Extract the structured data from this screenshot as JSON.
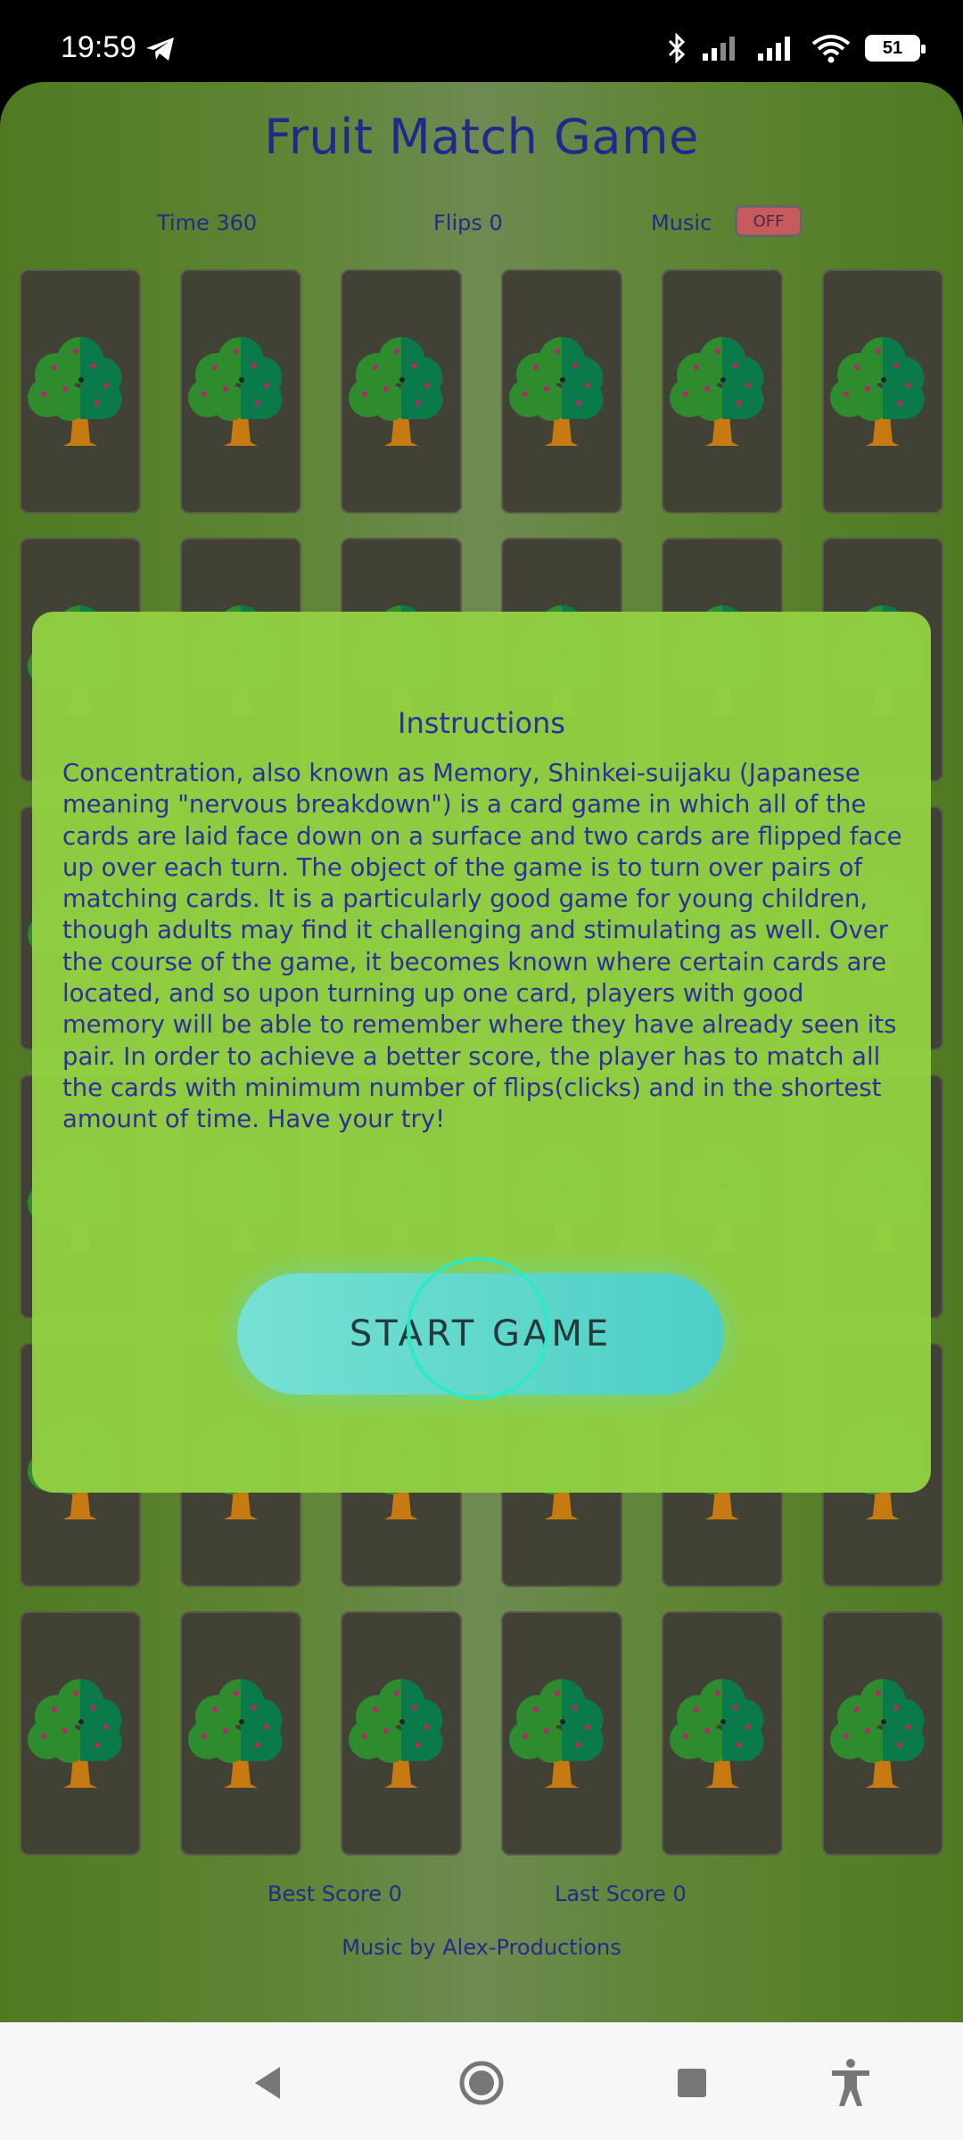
{
  "status_bar": {
    "time": "19:59",
    "battery": "51",
    "icons": [
      "telegram-icon",
      "bluetooth-icon",
      "signal-icon",
      "signal-icon",
      "wifi-icon",
      "battery-icon"
    ]
  },
  "game": {
    "title": "Fruit Match Game",
    "time_label": "Time 360",
    "flips_label": "Flips 0",
    "music_label": "Music",
    "music_toggle": "OFF",
    "card_back_icon": "tree-icon",
    "best_score": "Best Score 0",
    "last_score": "Last Score 0",
    "credit": "Music by Alex-Productions"
  },
  "instructions": {
    "title": "Instructions",
    "text": "Concentration, also known as Memory, Shinkei-suijaku (Japanese meaning \"nervous breakdown\") is a card game in which all of the cards are laid face down on a surface and two cards are flipped face up over each turn. The object of the game is to turn over pairs of matching cards. It is a particularly good game for young children, though adults may find it challenging and stimulating as well. Over the course of the game, it becomes known where certain cards are located, and so upon turning up one card, players with good memory will be able to remember where they have already seen its pair. In order to achieve a better score, the player has to match all the cards with minimum number of flips(clicks) and in the shortest amount of time. Have your try!",
    "start_button": "START GAME"
  },
  "colors": {
    "title_text": "#1f2a8a",
    "card_back": "#414136",
    "modal_bg": "#92d042",
    "button": "#5dd6cc",
    "toggle_off": "#c65a5c"
  }
}
